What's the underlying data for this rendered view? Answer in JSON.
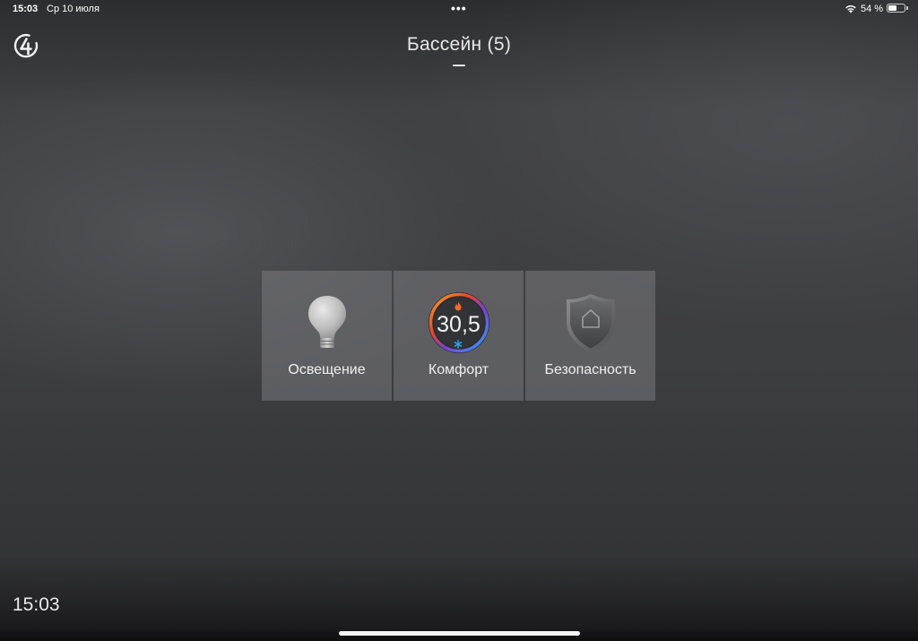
{
  "statusbar": {
    "time": "15:03",
    "date": "Ср 10 июля",
    "dots": "•••",
    "battery_text": "54 %",
    "battery_level": 0.54
  },
  "header": {
    "title": "Бассейн (5)"
  },
  "tiles": [
    {
      "label": "Освещение",
      "icon": "light-bulb-icon"
    },
    {
      "label": "Комфорт",
      "icon": "thermostat-icon",
      "temperature": "30,5"
    },
    {
      "label": "Безопасность",
      "icon": "shield-home-icon"
    }
  ],
  "footer": {
    "clock": "15:03"
  },
  "colors": {
    "heat": "#f26a2a",
    "cool": "#2aa8f2"
  }
}
